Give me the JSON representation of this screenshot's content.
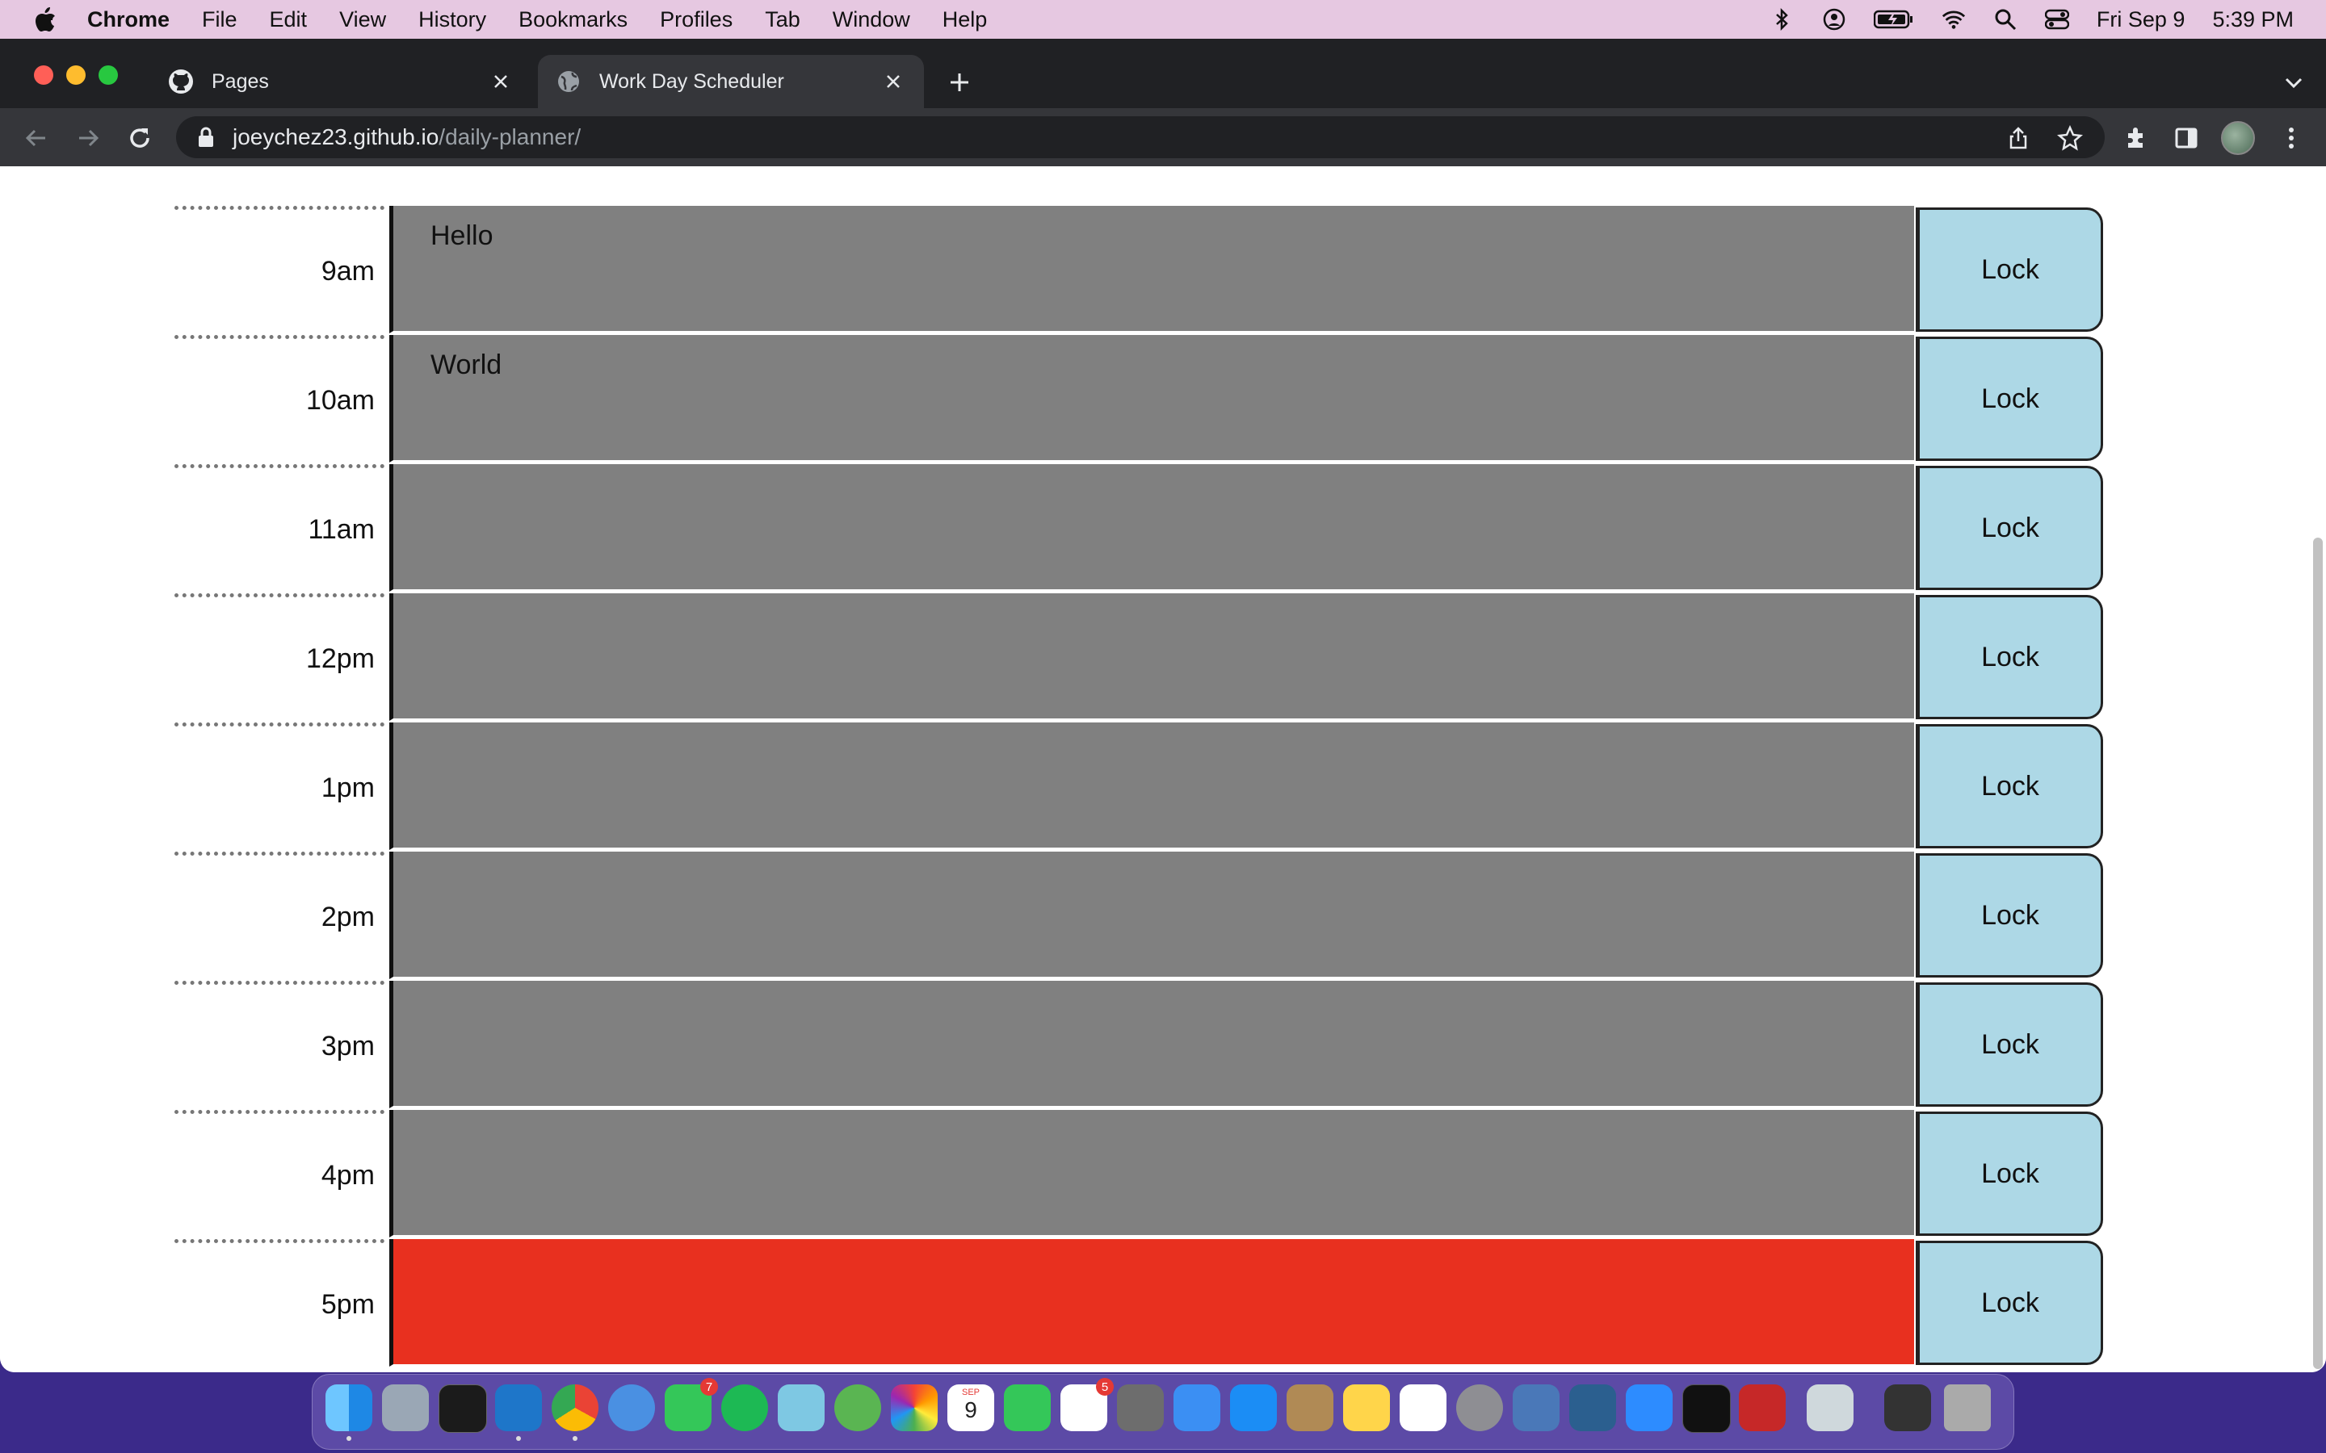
{
  "menubar": {
    "app": "Chrome",
    "items": [
      "File",
      "Edit",
      "View",
      "History",
      "Bookmarks",
      "Profiles",
      "Tab",
      "Window",
      "Help"
    ],
    "date": "Fri Sep 9",
    "time": "5:39 PM"
  },
  "tabs": [
    {
      "label": "Pages",
      "icon": "github-icon"
    },
    {
      "label": "Work Day Scheduler",
      "icon": "globe-icon"
    }
  ],
  "address": {
    "domain": "joeychez23.github.io",
    "path": "/daily-planner/"
  },
  "schedule": [
    {
      "hour": "9am",
      "text": "Hello",
      "state": "past",
      "button": "Lock"
    },
    {
      "hour": "10am",
      "text": "World",
      "state": "past",
      "button": "Lock"
    },
    {
      "hour": "11am",
      "text": "",
      "state": "past",
      "button": "Lock"
    },
    {
      "hour": "12pm",
      "text": "",
      "state": "past",
      "button": "Lock"
    },
    {
      "hour": "1pm",
      "text": "",
      "state": "past",
      "button": "Lock"
    },
    {
      "hour": "2pm",
      "text": "",
      "state": "past",
      "button": "Lock"
    },
    {
      "hour": "3pm",
      "text": "",
      "state": "past",
      "button": "Lock"
    },
    {
      "hour": "4pm",
      "text": "",
      "state": "past",
      "button": "Lock"
    },
    {
      "hour": "5pm",
      "text": "",
      "state": "present",
      "button": "Lock"
    }
  ],
  "colors": {
    "past": "#808080",
    "present": "#e8301f",
    "lock_button": "#add8e6"
  },
  "dock": {
    "badges": {
      "messages": "7",
      "reminders": "5"
    },
    "calendar_month": "SEP",
    "calendar_day": "9"
  }
}
